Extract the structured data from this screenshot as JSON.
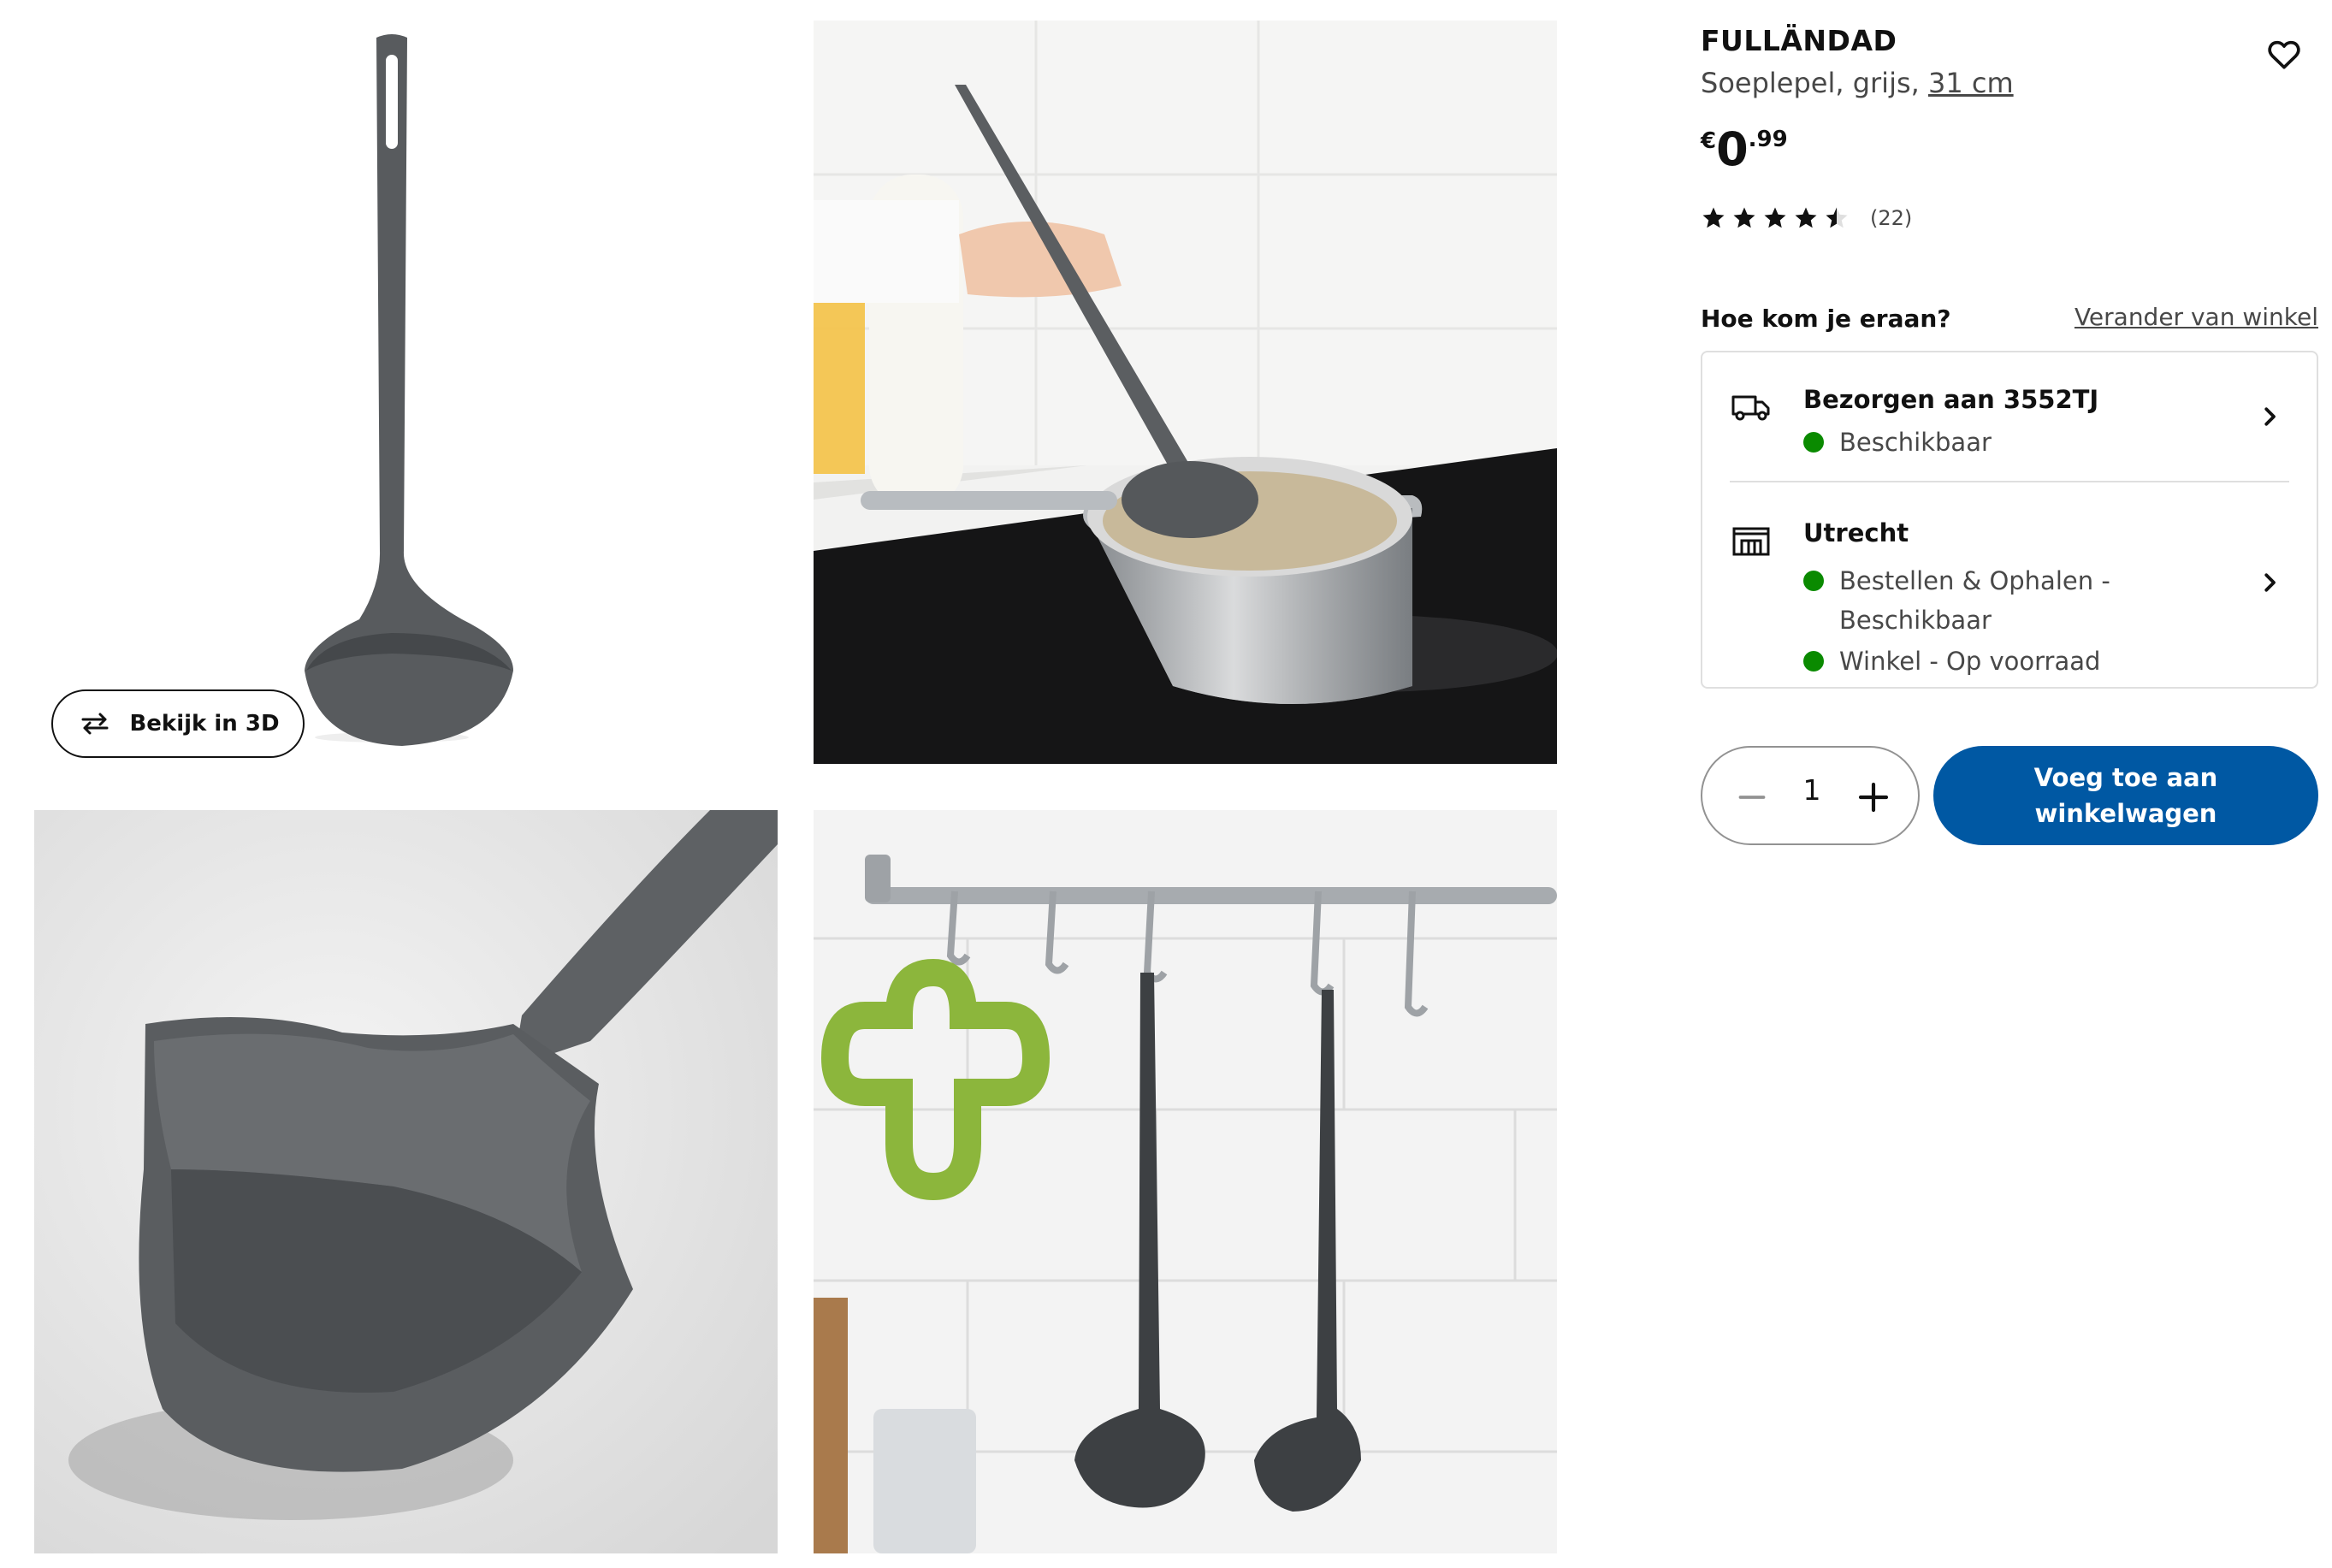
{
  "gallery": {
    "view_3d_label": "Bekijk in 3D"
  },
  "product": {
    "name": "FULLÄNDAD",
    "description": "Soeplepel, grijs,",
    "size": "31 cm",
    "price": {
      "currency": "€",
      "integer": "0",
      "decimals": ".99"
    },
    "rating": {
      "value": 4.5,
      "max": 5,
      "count_label": "(22)"
    },
    "favorite_icon": "heart-icon"
  },
  "availability": {
    "heading": "Hoe kom je eraan?",
    "change_store_label": "Verander van winkel",
    "delivery": {
      "title": "Bezorgen aan 3552TJ",
      "status": "Beschikbaar",
      "icon": "truck-icon"
    },
    "store": {
      "title": "Utrecht",
      "statuses": [
        "Bestellen & Ophalen - Beschikbaar",
        "Winkel - Op voorraad"
      ],
      "icon": "store-icon"
    },
    "status_color": "#0a8a00"
  },
  "cart": {
    "quantity": "1",
    "add_label": "Voeg toe aan winkelwagen",
    "button_color": "#0058a3"
  }
}
